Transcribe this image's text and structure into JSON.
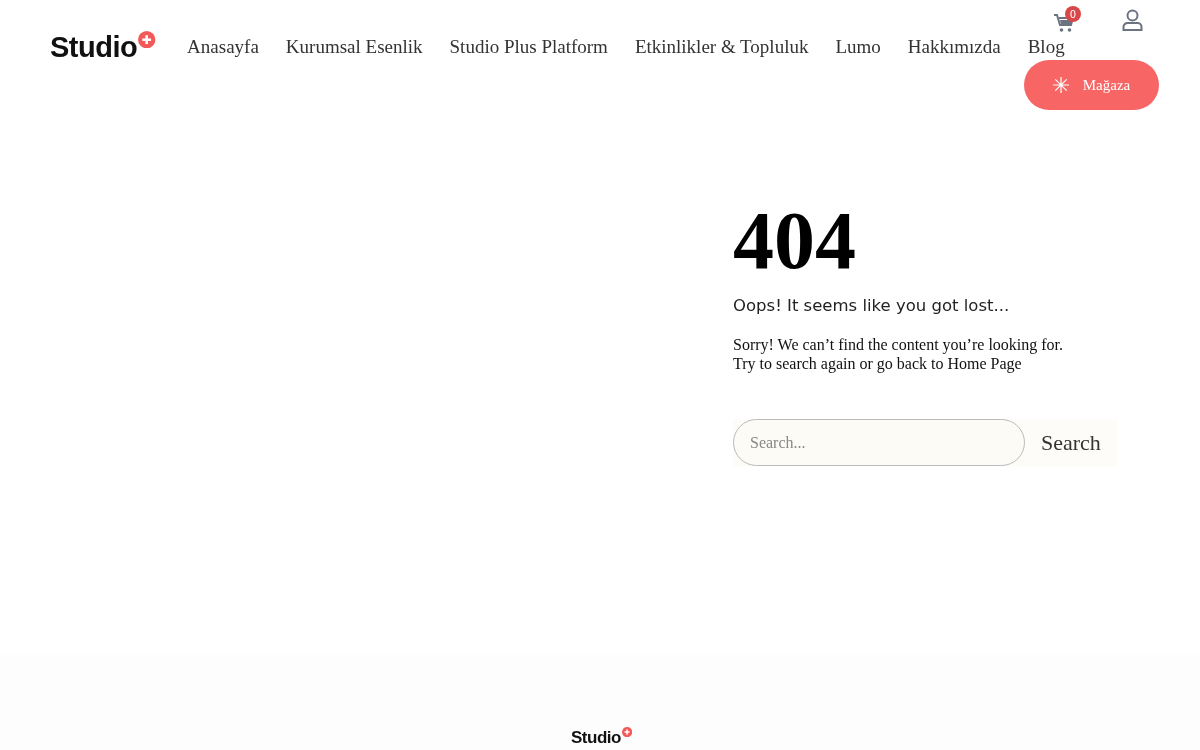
{
  "header": {
    "logo": "Studio",
    "nav": [
      {
        "label": "Anasayfa"
      },
      {
        "label": "Kurumsal Esenlik"
      },
      {
        "label": "Studio Plus Platform"
      },
      {
        "label": "Etkinlikler & Topluluk"
      },
      {
        "label": "Lumo"
      },
      {
        "label": "Hakkımızda"
      },
      {
        "label": "Blog"
      }
    ],
    "cart_count": "0",
    "shop_button": "Mağaza"
  },
  "error": {
    "code": "404",
    "title": "Oops! It seems like you got lost...",
    "message": [
      "Sorry! We can’t find the content you’re looking for.",
      "Try to search again or go back to Home Page"
    ]
  },
  "search": {
    "placeholder": "Search...",
    "button": "Search"
  },
  "footer": {
    "logo": "Studio"
  }
}
